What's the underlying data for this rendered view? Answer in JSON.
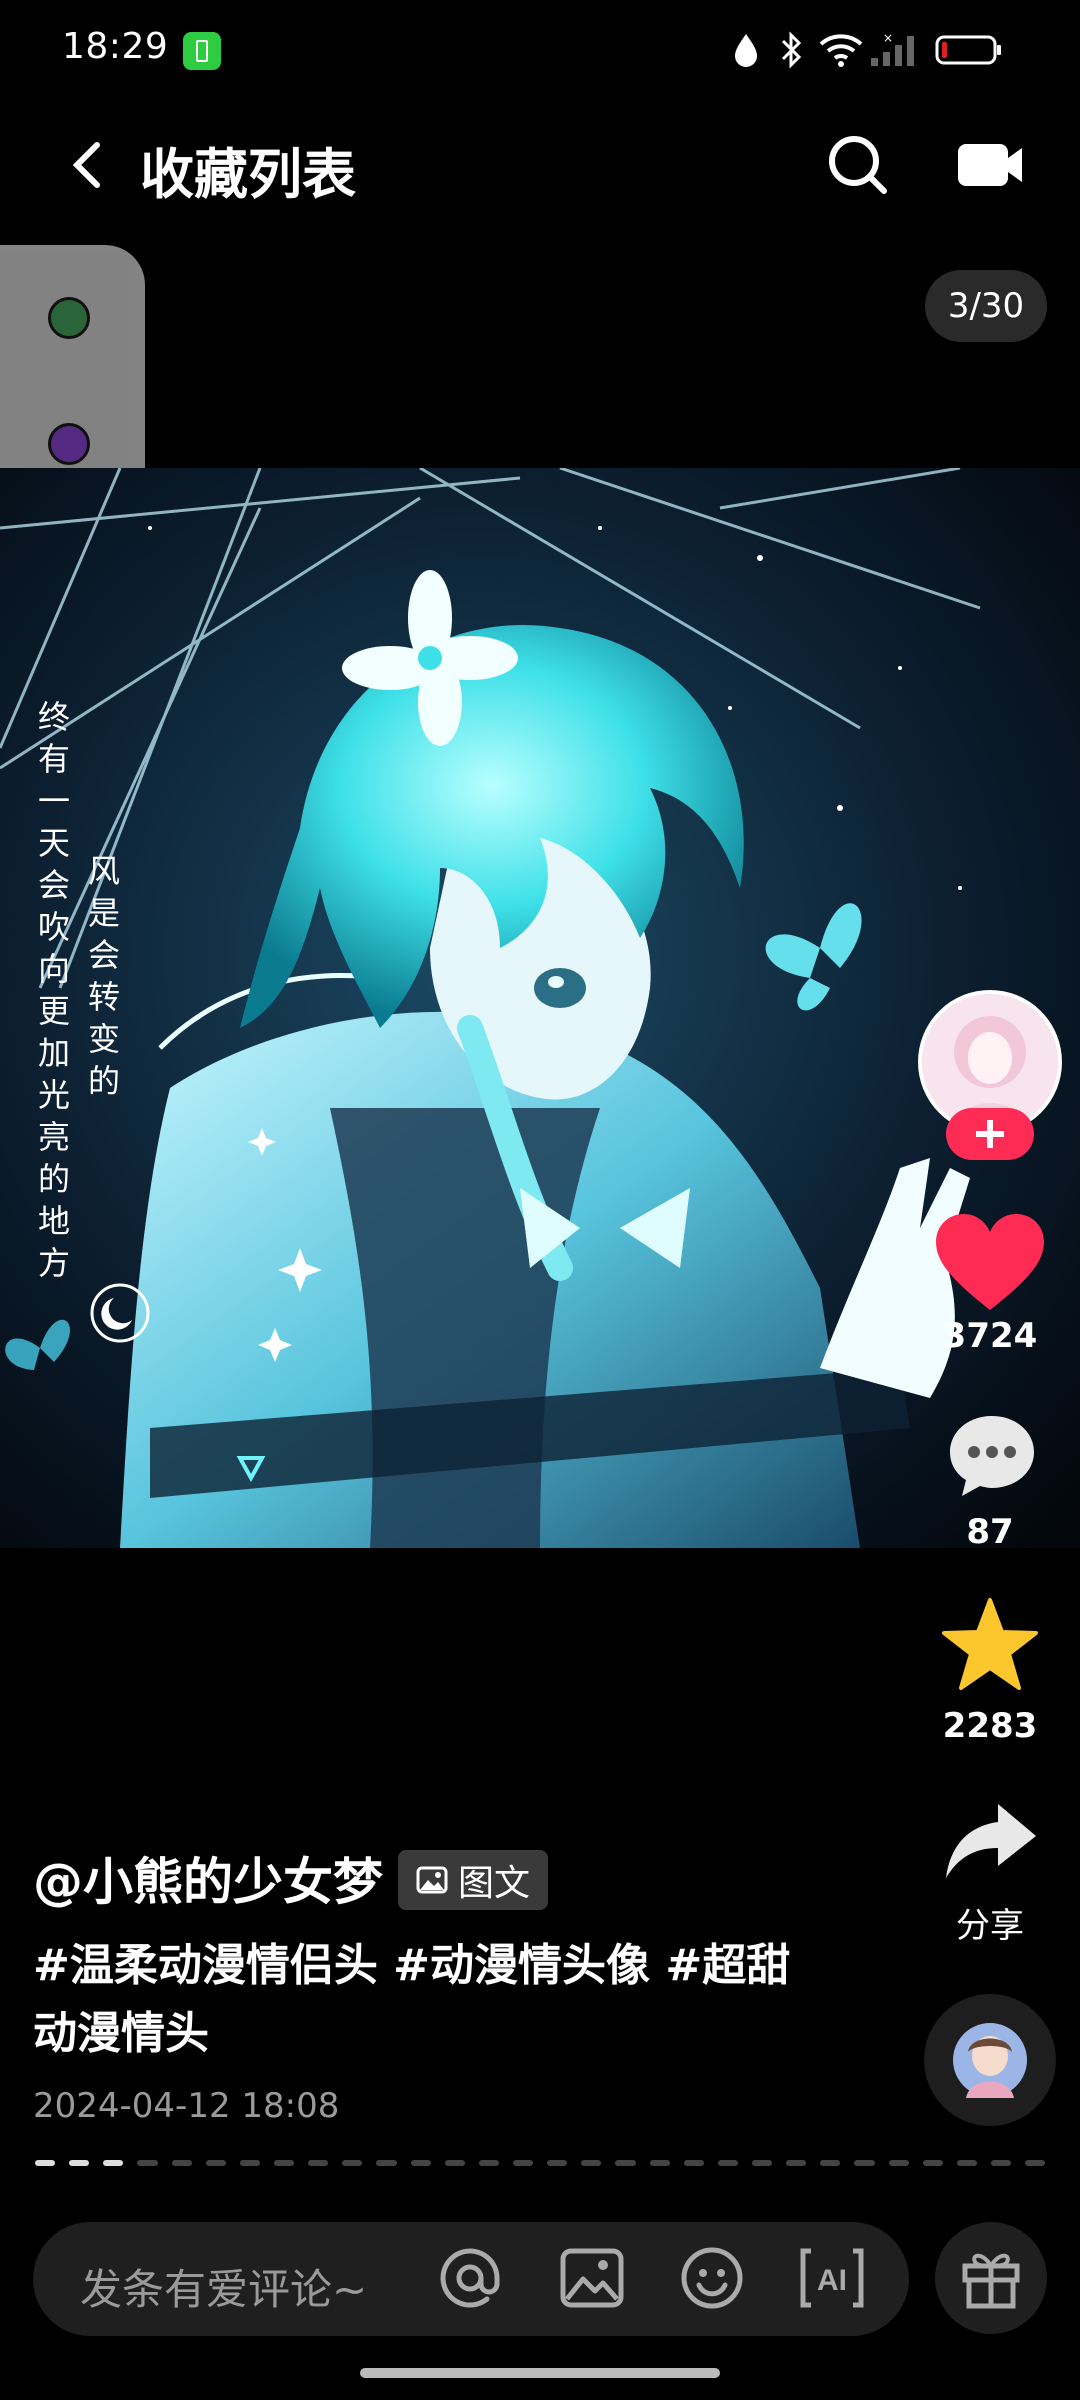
{
  "status_bar": {
    "time": "18:29",
    "icons": [
      "battery-saver-icon",
      "droplet-icon",
      "bluetooth-icon",
      "wifi-icon",
      "signal-icon",
      "battery-icon"
    ]
  },
  "header": {
    "title": "收藏列表",
    "back_icon": "chevron-left-icon",
    "search_icon": "search-icon",
    "camera_icon": "camera-icon"
  },
  "page_counter": "3/30",
  "image": {
    "vertical_text_left": "终有一天会吹向更加光亮的地方",
    "vertical_text_right": "风是会转变的"
  },
  "actions": {
    "likes": "3724",
    "comments": "87",
    "favorites": "2283",
    "share_label": "分享",
    "like_color": "#fe2c55",
    "favorite_color": "#fbc72c"
  },
  "caption": {
    "author": "@小熊的少女梦",
    "post_type": "图文",
    "hashtags": "#温柔动漫情侣头 #动漫情头像 #超甜动漫情头",
    "date": "2024-04-12 18:08"
  },
  "progress": {
    "current": 3,
    "total": 30
  },
  "comment_bar": {
    "placeholder": "发条有爱评论~",
    "icons": [
      "at-icon",
      "image-icon",
      "emoji-icon",
      "ai-icon",
      "gift-icon"
    ]
  }
}
